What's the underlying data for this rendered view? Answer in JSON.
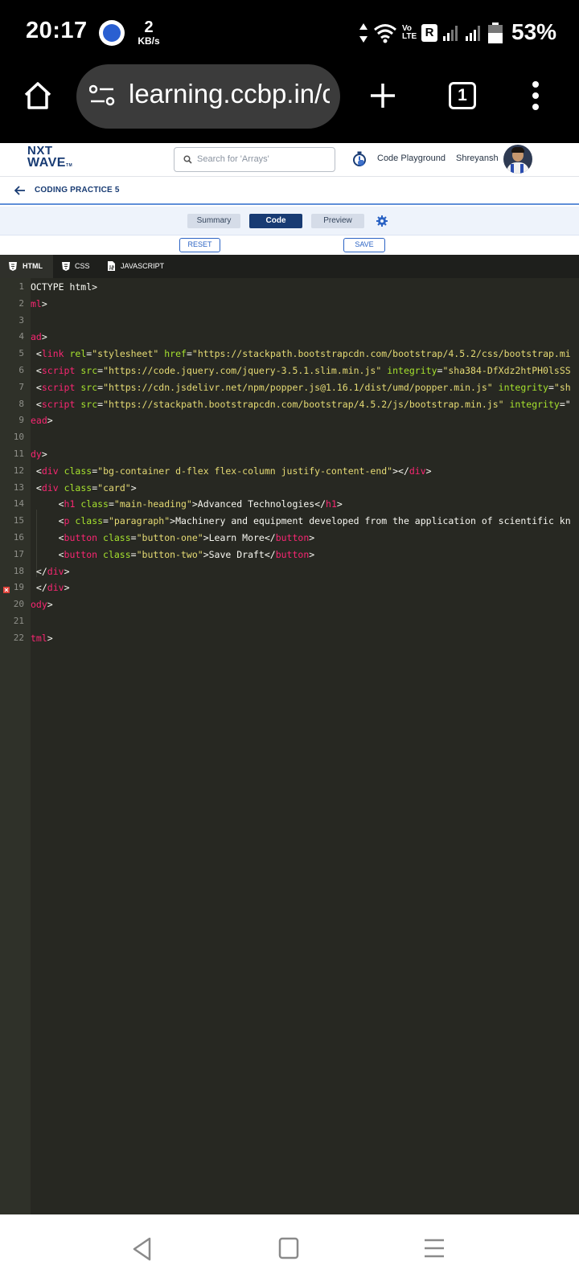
{
  "status": {
    "time": "20:17",
    "speed_num": "2",
    "speed_unit": "KB/s",
    "battery": "53%",
    "volte": "Vo LTE",
    "r_badge": "R"
  },
  "browser": {
    "url": "learning.ccbp.in/c",
    "tab_count": "1"
  },
  "site": {
    "logo_line1": "NXT",
    "logo_line2": "WAVE",
    "logo_tm": "TM",
    "search_placeholder": "Search for 'Arrays'",
    "playground": "Code Playground",
    "user": "Shreyansh"
  },
  "breadcrumb": {
    "title": "CODING PRACTICE 5"
  },
  "view_tabs": {
    "summary": "Summary",
    "code": "Code",
    "preview": "Preview"
  },
  "actions": {
    "reset": "RESET",
    "save": "SAVE"
  },
  "editor_tabs": {
    "html": "HTML",
    "css": "CSS",
    "js": "JAVASCRIPT"
  },
  "lines": [
    {
      "n": "1",
      "segs": [
        [
          "t",
          "OCTYPE html>"
        ]
      ]
    },
    {
      "n": "2",
      "segs": [
        [
          "tag",
          "ml"
        ],
        [
          "t",
          ">"
        ]
      ]
    },
    {
      "n": "3",
      "segs": []
    },
    {
      "n": "4",
      "segs": [
        [
          "tag",
          "ad"
        ],
        [
          "t",
          ">"
        ]
      ]
    },
    {
      "n": "5",
      "segs": [
        [
          "t",
          " <"
        ],
        [
          "tag",
          "link"
        ],
        [
          "t",
          " "
        ],
        [
          "attr",
          "rel"
        ],
        [
          "t",
          "="
        ],
        [
          "str",
          "\"stylesheet\""
        ],
        [
          "t",
          " "
        ],
        [
          "attr",
          "href"
        ],
        [
          "t",
          "="
        ],
        [
          "str",
          "\"https://stackpath.bootstrapcdn.com/bootstrap/4.5.2/css/bootstrap.mi"
        ]
      ]
    },
    {
      "n": "6",
      "segs": [
        [
          "t",
          " <"
        ],
        [
          "tag",
          "script"
        ],
        [
          "t",
          " "
        ],
        [
          "attr",
          "src"
        ],
        [
          "t",
          "="
        ],
        [
          "str",
          "\"https://code.jquery.com/jquery-3.5.1.slim.min.js\""
        ],
        [
          "t",
          " "
        ],
        [
          "attr",
          "integrity"
        ],
        [
          "t",
          "="
        ],
        [
          "str",
          "\"sha384-DfXdz2htPH0lsSS"
        ]
      ]
    },
    {
      "n": "7",
      "segs": [
        [
          "t",
          " <"
        ],
        [
          "tag",
          "script"
        ],
        [
          "t",
          " "
        ],
        [
          "attr",
          "src"
        ],
        [
          "t",
          "="
        ],
        [
          "str",
          "\"https://cdn.jsdelivr.net/npm/popper.js@1.16.1/dist/umd/popper.min.js\""
        ],
        [
          "t",
          " "
        ],
        [
          "attr",
          "integrity"
        ],
        [
          "t",
          "="
        ],
        [
          "str",
          "\"sh"
        ]
      ]
    },
    {
      "n": "8",
      "segs": [
        [
          "t",
          " <"
        ],
        [
          "tag",
          "script"
        ],
        [
          "t",
          " "
        ],
        [
          "attr",
          "src"
        ],
        [
          "t",
          "="
        ],
        [
          "str",
          "\"https://stackpath.bootstrapcdn.com/bootstrap/4.5.2/js/bootstrap.min.js\""
        ],
        [
          "t",
          " "
        ],
        [
          "attr",
          "integrity"
        ],
        [
          "t",
          "=\""
        ]
      ]
    },
    {
      "n": "9",
      "segs": [
        [
          "tag",
          "ead"
        ],
        [
          "t",
          ">"
        ]
      ]
    },
    {
      "n": "10",
      "segs": []
    },
    {
      "n": "11",
      "segs": [
        [
          "tag",
          "dy"
        ],
        [
          "t",
          ">"
        ]
      ]
    },
    {
      "n": "12",
      "segs": [
        [
          "t",
          " <"
        ],
        [
          "tag",
          "div"
        ],
        [
          "t",
          " "
        ],
        [
          "attr",
          "class"
        ],
        [
          "t",
          "="
        ],
        [
          "str",
          "\"bg-container d-flex flex-column justify-content-end\""
        ],
        [
          "t",
          "></"
        ],
        [
          "tag",
          "div"
        ],
        [
          "t",
          ">"
        ]
      ]
    },
    {
      "n": "13",
      "segs": [
        [
          "t",
          " <"
        ],
        [
          "tag",
          "div"
        ],
        [
          "t",
          " "
        ],
        [
          "attr",
          "class"
        ],
        [
          "t",
          "="
        ],
        [
          "str",
          "\"card\""
        ],
        [
          "t",
          ">"
        ]
      ]
    },
    {
      "n": "14",
      "segs": [
        [
          "t",
          "     <"
        ],
        [
          "tag",
          "h1"
        ],
        [
          "t",
          " "
        ],
        [
          "attr",
          "class"
        ],
        [
          "t",
          "="
        ],
        [
          "str",
          "\"main-heading\""
        ],
        [
          "t",
          ">Advanced Technologies</"
        ],
        [
          "tag",
          "h1"
        ],
        [
          "t",
          ">"
        ]
      ]
    },
    {
      "n": "15",
      "segs": [
        [
          "t",
          "     <"
        ],
        [
          "tag",
          "p"
        ],
        [
          "t",
          " "
        ],
        [
          "attr",
          "class"
        ],
        [
          "t",
          "="
        ],
        [
          "str",
          "\"paragraph\""
        ],
        [
          "t",
          ">Machinery and equipment developed from the application of scientific kn"
        ]
      ]
    },
    {
      "n": "16",
      "segs": [
        [
          "t",
          "     <"
        ],
        [
          "tag",
          "button"
        ],
        [
          "t",
          " "
        ],
        [
          "attr",
          "class"
        ],
        [
          "t",
          "="
        ],
        [
          "str",
          "\"button-one\""
        ],
        [
          "t",
          ">Learn More</"
        ],
        [
          "tag",
          "button"
        ],
        [
          "t",
          ">"
        ]
      ]
    },
    {
      "n": "17",
      "segs": [
        [
          "t",
          "     <"
        ],
        [
          "tag",
          "button"
        ],
        [
          "t",
          " "
        ],
        [
          "attr",
          "class"
        ],
        [
          "t",
          "="
        ],
        [
          "str",
          "\"button-two\""
        ],
        [
          "t",
          ">Save Draft</"
        ],
        [
          "tag",
          "button"
        ],
        [
          "t",
          ">"
        ]
      ]
    },
    {
      "n": "18",
      "segs": [
        [
          "t",
          " </"
        ],
        [
          "tag",
          "div"
        ],
        [
          "t",
          ">"
        ]
      ]
    },
    {
      "n": "19",
      "segs": [
        [
          "t",
          " </"
        ],
        [
          "tag",
          "div"
        ],
        [
          "t",
          ">"
        ]
      ]
    },
    {
      "n": "20",
      "segs": [
        [
          "tag",
          "ody"
        ],
        [
          "t",
          ">"
        ]
      ]
    },
    {
      "n": "21",
      "segs": []
    },
    {
      "n": "22",
      "segs": [
        [
          "tag",
          "tml"
        ],
        [
          "t",
          ">"
        ]
      ]
    }
  ],
  "colors": {
    "brand": "#183b73",
    "accent": "#2b63c4",
    "editor_bg": "#272822",
    "tag": "#f92672",
    "attr": "#a6e22e",
    "string": "#e6db74",
    "error": "#e0433a"
  },
  "icons": [
    "home-icon",
    "site-settings-icon",
    "plus-icon",
    "tabs-icon",
    "more-icon",
    "search-icon",
    "stopwatch-icon",
    "back-arrow-icon",
    "gear-icon",
    "html5-icon",
    "css3-icon",
    "js-file-icon",
    "error-marker-icon",
    "nav-back-icon",
    "nav-home-icon",
    "nav-recents-icon"
  ]
}
